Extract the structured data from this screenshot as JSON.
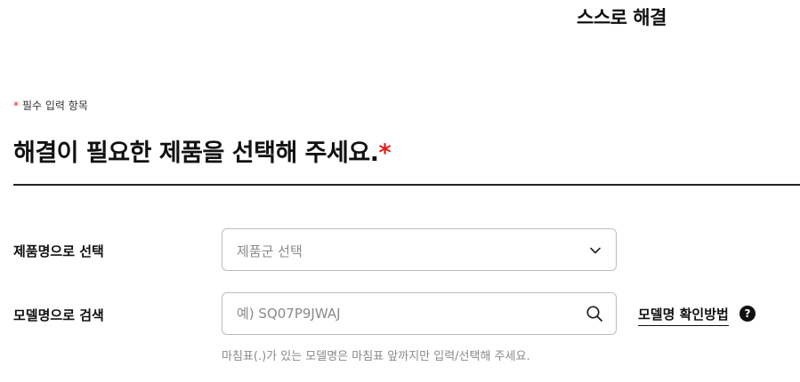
{
  "header": {
    "title": "스스로 해결"
  },
  "form": {
    "required_star": "*",
    "required_note": "필수 입력 항목",
    "section_title": "해결이 필요한 제품을 선택해 주세요.",
    "section_title_star": "*",
    "select_row": {
      "label": "제품명으로 선택",
      "placeholder": "제품군 선택",
      "icon": "chevron-down-icon"
    },
    "search_row": {
      "label": "모델명으로 검색",
      "placeholder": "예) SQ07P9JWAJ",
      "value": "",
      "icon": "search-icon",
      "help_link": "모델명 확인방법",
      "help_icon_glyph": "?"
    },
    "hint": "마침표(.)가 있는 모델명은 마침표 앞까지만 입력/선택해 주세요."
  },
  "colors": {
    "accent_red": "#e0201c",
    "text_primary": "#111111",
    "text_muted": "#8a8a8a",
    "border": "#bdbdbd"
  }
}
